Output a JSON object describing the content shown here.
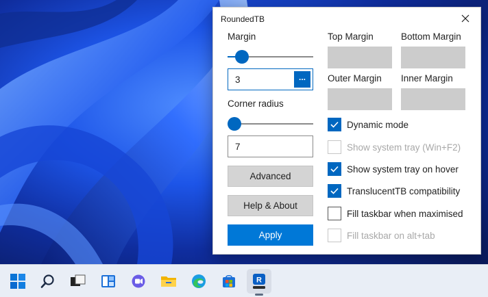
{
  "window": {
    "title": "RoundedTB",
    "close_icon": "close-icon"
  },
  "left": {
    "margin_label": "Margin",
    "margin_slider_fraction": 0.17,
    "margin_value": "3",
    "margin_more_button": "...",
    "corner_radius_label": "Corner radius",
    "corner_radius_slider_fraction": 0.08,
    "corner_radius_value": "7",
    "advanced_button": "Advanced",
    "help_button": "Help & About",
    "apply_button": "Apply"
  },
  "right": {
    "top_margin_label": "Top Margin",
    "bottom_margin_label": "Bottom Margin",
    "outer_margin_label": "Outer Margin",
    "inner_margin_label": "Inner Margin",
    "checkboxes": [
      {
        "label": "Dynamic mode",
        "checked": true,
        "disabled": false
      },
      {
        "label": "Show system tray (Win+F2)",
        "checked": false,
        "disabled": true
      },
      {
        "label": "Show system tray on hover",
        "checked": true,
        "disabled": false
      },
      {
        "label": "TranslucentTB compatibility",
        "checked": true,
        "disabled": false
      },
      {
        "label": "Fill taskbar when maximised",
        "checked": false,
        "disabled": false
      },
      {
        "label": "Fill taskbar on alt+tab",
        "checked": false,
        "disabled": true
      }
    ]
  },
  "taskbar": {
    "icons": [
      "windows-start-icon",
      "search-icon",
      "task-view-icon",
      "widgets-icon",
      "teams-chat-icon",
      "file-explorer-icon",
      "edge-icon",
      "microsoft-store-icon",
      "roundedtb-app-icon"
    ],
    "active": "roundedtb-app-icon"
  },
  "colors": {
    "accent": "#0067c0",
    "button_primary": "#0078d7",
    "disabled_box": "#cccccc"
  }
}
